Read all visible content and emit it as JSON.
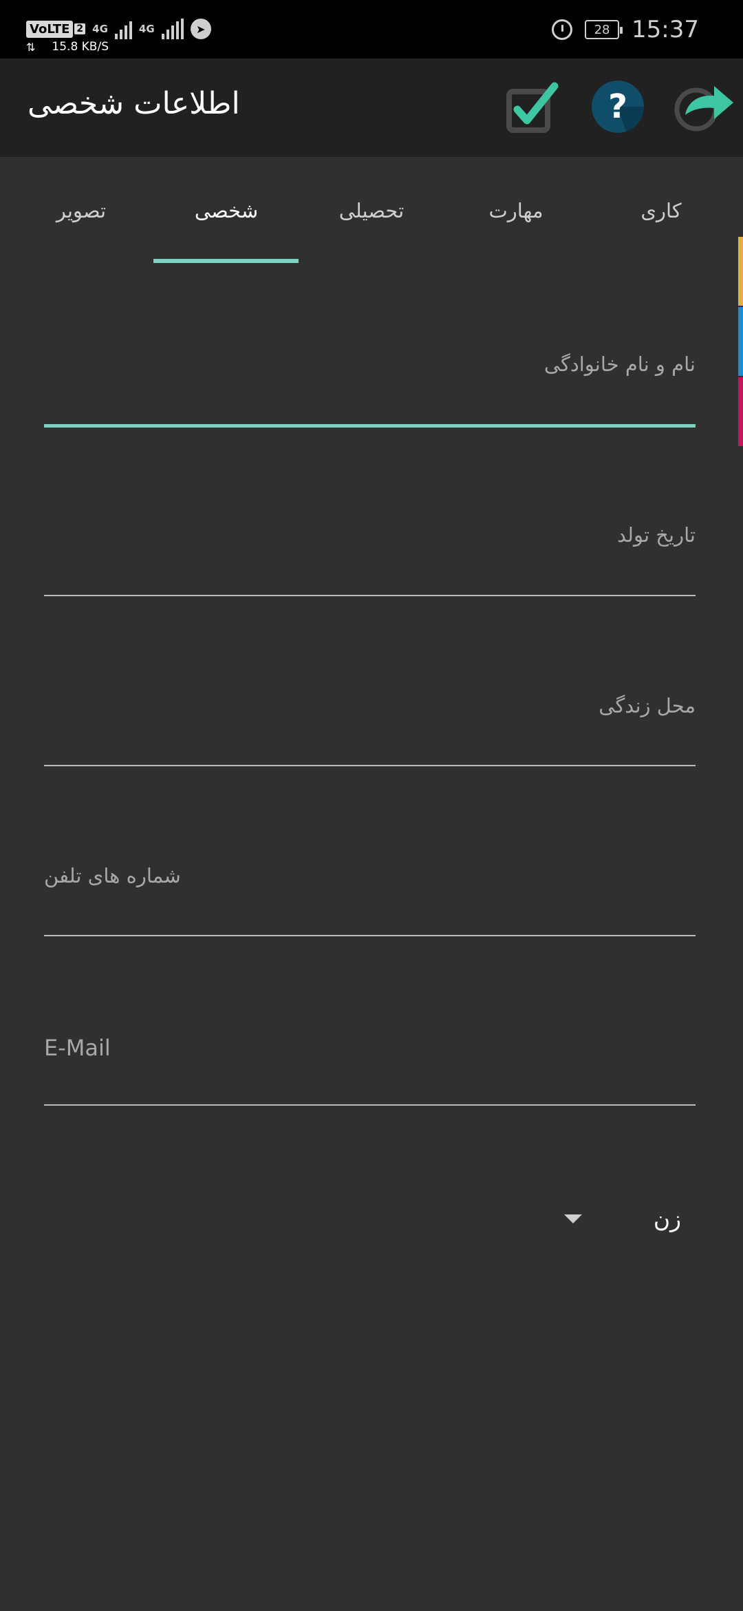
{
  "status_bar": {
    "volte": "VoLTE",
    "sim_slot": "2",
    "network_1": "4G",
    "network_2": "4G",
    "speed": "15.8 KB/S",
    "battery": "28",
    "time": "15:37"
  },
  "app_bar": {
    "title": "اطلاعات شخصی",
    "accent_color": "#3ec5a1"
  },
  "tabs": [
    {
      "label": "کاری",
      "active": false
    },
    {
      "label": "مهارت",
      "active": false
    },
    {
      "label": "تحصیلی",
      "active": false
    },
    {
      "label": "شخصی",
      "active": true
    },
    {
      "label": "تصویر",
      "active": false
    }
  ],
  "form": {
    "full_name": {
      "label": "نام و نام خانوادگی",
      "value": ""
    },
    "birth_date": {
      "label": "تاریخ تولد",
      "value": ""
    },
    "residence": {
      "label": "محل زندگی",
      "value": ""
    },
    "phones": {
      "label": "شماره های تلفن",
      "value": ""
    },
    "email": {
      "label": "E-Mail",
      "value": ""
    },
    "gender": {
      "selected": "زن"
    }
  },
  "side_strip_colors": [
    "#e3b23c",
    "#1a8fd0",
    "#c2185b"
  ],
  "icons": {
    "save": "checkbox-check-icon",
    "help": "help-circle-icon",
    "share": "share-arrow-icon"
  }
}
